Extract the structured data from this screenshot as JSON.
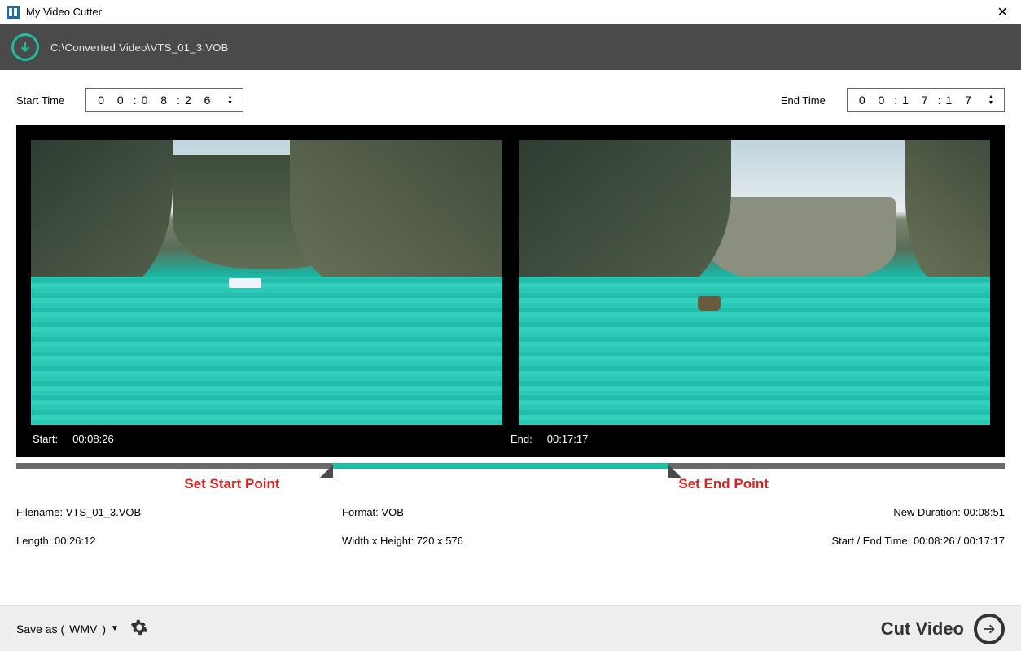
{
  "window": {
    "title": "My Video Cutter"
  },
  "header": {
    "filepath": "C:\\Converted Video\\VTS_01_3.VOB"
  },
  "start": {
    "label": "Start Time",
    "hh": "0 0",
    "mm": "0 8",
    "ss": "2 6",
    "preview_label": "Start:",
    "preview_value": "00:08:26"
  },
  "end": {
    "label": "End Time",
    "hh": "0 0",
    "mm": "1 7",
    "ss": "1 7",
    "preview_label": "End:",
    "preview_value": "00:17:17"
  },
  "hints": {
    "start": "Set Start Point",
    "end": "Set End Point"
  },
  "info": {
    "filename_label": "Filename:",
    "filename_value": "VTS_01_3.VOB",
    "format_label": "Format:",
    "format_value": "VOB",
    "newdur_label": "New Duration:",
    "newdur_value": "00:08:51",
    "length_label": "Length:",
    "length_value": "00:26:12",
    "wh_label": "Width x Height:",
    "wh_value": "720 x 576",
    "se_label": "Start / End Time:",
    "se_value": "00:08:26 / 00:17:17"
  },
  "footer": {
    "saveas_prefix": "Save as (",
    "saveas_format": "WMV",
    "saveas_suffix": ")",
    "cut_label": "Cut Video"
  }
}
